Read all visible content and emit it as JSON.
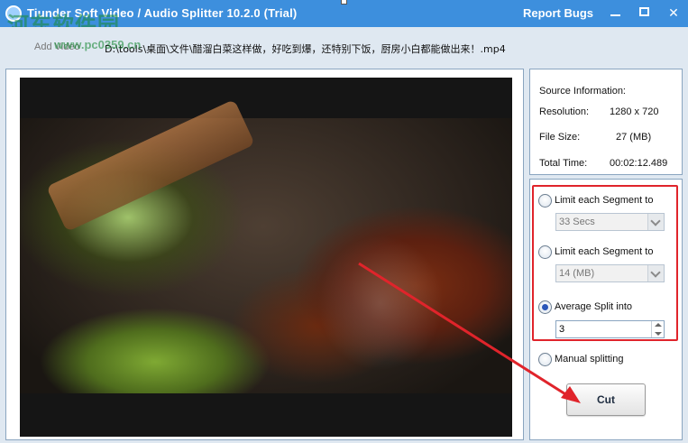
{
  "window": {
    "title": "Tiunder Soft Video / Audio Splitter 10.2.0 (Trial)",
    "report_bugs": "Report Bugs",
    "minimize_icon": "minimize-icon",
    "maximize_icon": "maximize-icon",
    "close_icon": "close-icon",
    "close_glyph": "✕"
  },
  "watermark": {
    "text": "河东软件园",
    "url": "www.pc0359.cn"
  },
  "file": {
    "label": "Add Video",
    "path": "D:\\tools\\桌面\\文件\\醋溜白菜这样做，好吃到爆，还特别下饭，厨房小白都能做出来！.mp4"
  },
  "source_info": {
    "heading": "Source Information:",
    "resolution_label": "Resolution:",
    "resolution_value": "1280 x 720",
    "file_size_label": "File Size:",
    "file_size_value": "27 (MB)",
    "total_time_label": "Total Time:",
    "total_time_value": "00:02:12.489"
  },
  "options": {
    "limit_time_label": "Limit each Segment to",
    "limit_time_value": "33 Secs",
    "limit_size_label": "Limit each Segment to",
    "limit_size_value": "14 (MB)",
    "average_label": "Average Split into",
    "average_value": "3",
    "manual_label": "Manual splitting",
    "selected": "average"
  },
  "actions": {
    "cut_label": "Cut"
  },
  "colors": {
    "titlebar": "#3d8fdd",
    "highlight": "#e0242b",
    "accent_radio": "#2a56b8"
  }
}
